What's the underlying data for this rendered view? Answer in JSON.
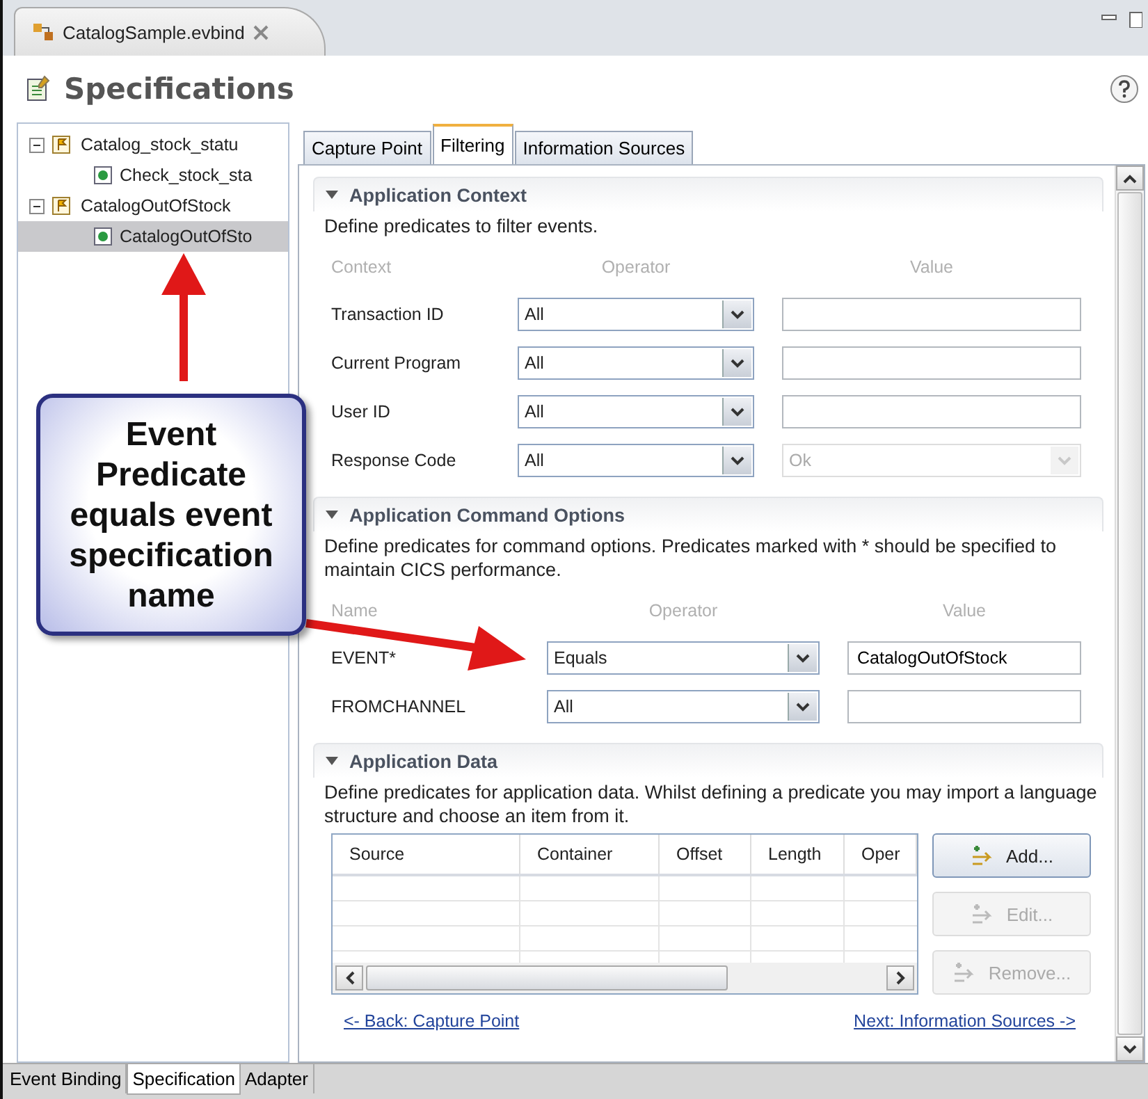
{
  "editor_tab": {
    "title": "CatalogSample.evbind"
  },
  "header": {
    "title": "Specifications"
  },
  "tree": [
    {
      "label": "Catalog_stock_statu",
      "expanded": true,
      "selected": false,
      "children": [
        {
          "label": "Check_stock_sta",
          "selected": false
        }
      ]
    },
    {
      "label": "CatalogOutOfStock",
      "expanded": true,
      "selected": false,
      "children": [
        {
          "label": "CatalogOutOfSto",
          "selected": true
        }
      ]
    }
  ],
  "form_tabs": [
    {
      "label": "Capture Point",
      "selected": false
    },
    {
      "label": "Filtering",
      "selected": true
    },
    {
      "label": "Information Sources",
      "selected": false
    }
  ],
  "sections": [
    {
      "title": "Application Context",
      "expanded": true,
      "description": "Define predicates to filter events.",
      "columns": [
        "Context",
        "Operator",
        "Value"
      ],
      "rows": [
        {
          "label": "Transaction ID",
          "operator": "All",
          "kind": "text",
          "value": "",
          "disabled": false
        },
        {
          "label": "Current Program",
          "operator": "All",
          "kind": "text",
          "value": "",
          "disabled": false
        },
        {
          "label": "User ID",
          "operator": "All",
          "kind": "text",
          "value": "",
          "disabled": false
        },
        {
          "label": "Response Code",
          "operator": "All",
          "kind": "combo",
          "value": "Ok",
          "disabled": true
        }
      ]
    },
    {
      "title": "Application Command Options",
      "expanded": true,
      "description": "Define predicates for command options. Predicates marked with * should be specified to maintain CICS performance.",
      "columns": [
        "Name",
        "Operator",
        "Value"
      ],
      "rows": [
        {
          "label": "EVENT*",
          "operator": "Equals",
          "kind": "text",
          "value": "CatalogOutOfStock",
          "disabled": false
        },
        {
          "label": "FROMCHANNEL",
          "operator": "All",
          "kind": "text",
          "value": "",
          "disabled": false
        }
      ]
    }
  ],
  "data_section": {
    "title": "Application Data",
    "expanded": true,
    "description": "Define predicates for application data. Whilst defining a predicate you may import a language structure and choose an item from it.",
    "columns": [
      "Source",
      "Container",
      "Offset",
      "Length",
      "Oper"
    ],
    "buttons": [
      {
        "label": "Add...",
        "disabled": false
      },
      {
        "label": "Edit...",
        "disabled": true
      },
      {
        "label": "Remove...",
        "disabled": true
      }
    ]
  },
  "links": {
    "back": "<- Back: Capture Point",
    "next": "Next: Information Sources ->"
  },
  "bottom_tabs": [
    {
      "label": "Event Binding",
      "selected": false
    },
    {
      "label": "Specification",
      "selected": true
    },
    {
      "label": "Adapter",
      "selected": false
    }
  ],
  "callout": {
    "text": "Event Predicate equals event specification name"
  }
}
